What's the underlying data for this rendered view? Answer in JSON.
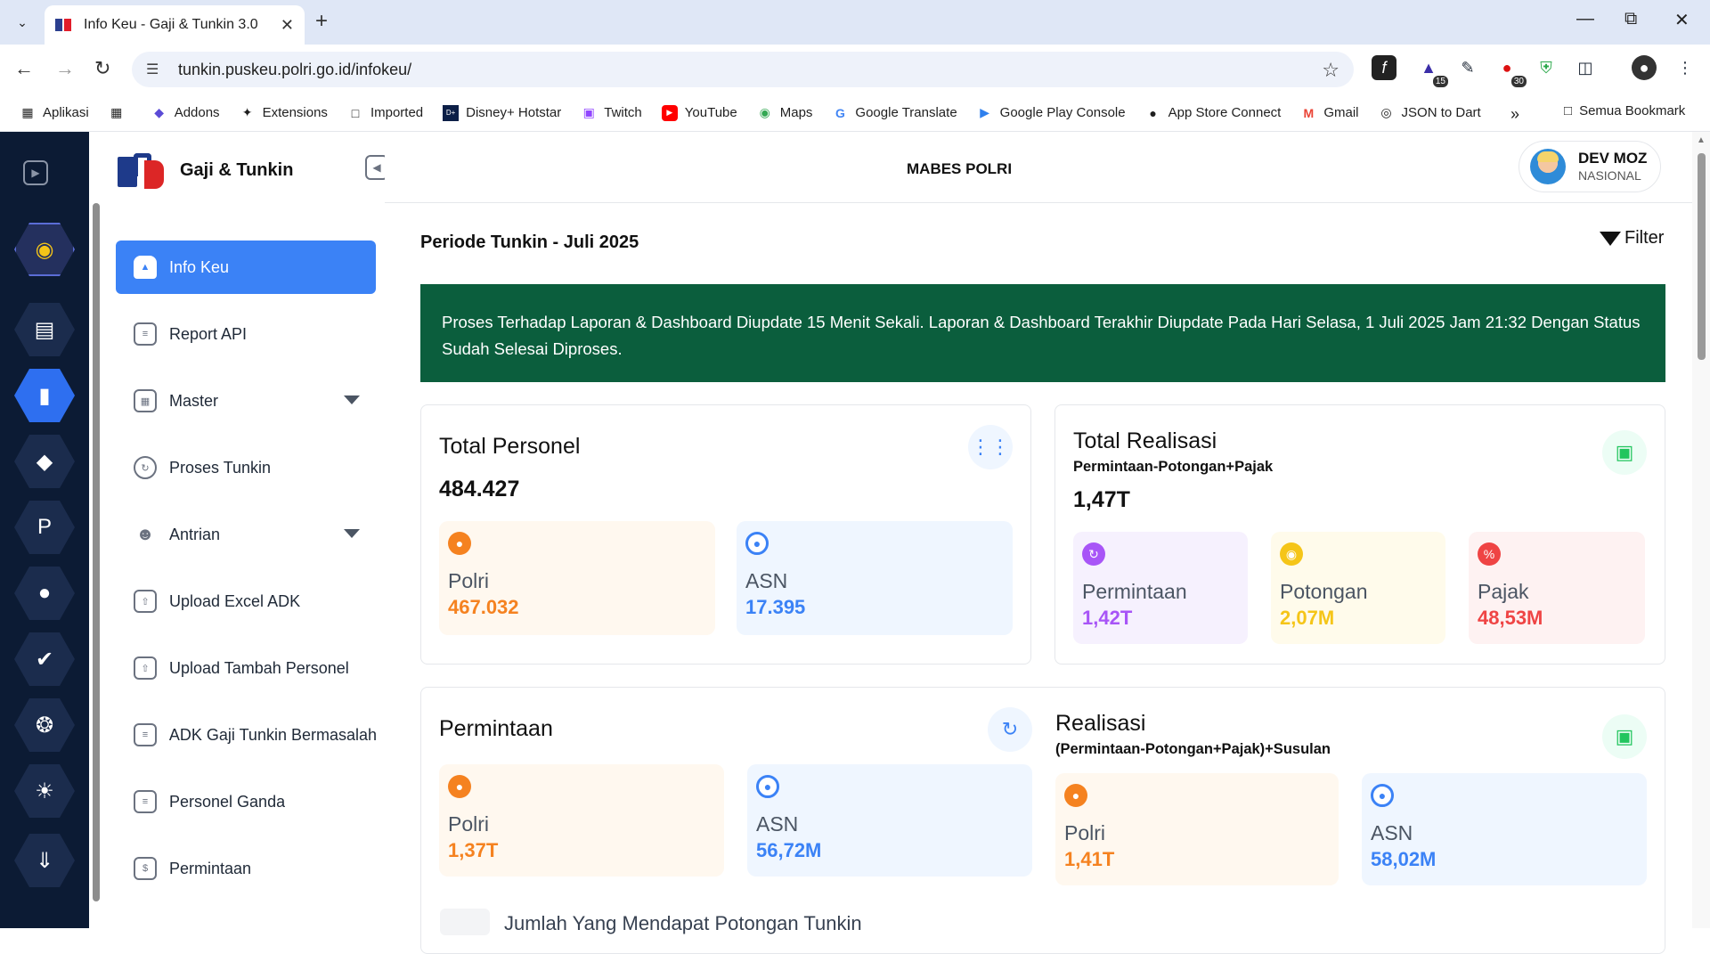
{
  "browser": {
    "tab_title": "Info Keu - Gaji & Tunkin 3.0",
    "url": "tunkin.puskeu.polri.go.id/infokeu/",
    "bookmarks": [
      {
        "label": "Aplikasi",
        "icon": "apps-grid-icon"
      },
      {
        "label": "",
        "icon": "grid-icon"
      },
      {
        "label": "Addons",
        "icon": "addons-icon"
      },
      {
        "label": "Extensions",
        "icon": "puzzle-icon"
      },
      {
        "label": "Imported",
        "icon": "folder-icon"
      },
      {
        "label": "Disney+ Hotstar",
        "icon": "hotstar-icon"
      },
      {
        "label": "Twitch",
        "icon": "twitch-icon"
      },
      {
        "label": "YouTube",
        "icon": "youtube-icon"
      },
      {
        "label": "Maps",
        "icon": "maps-icon"
      },
      {
        "label": "Google Translate",
        "icon": "google-icon"
      },
      {
        "label": "Google Play Console",
        "icon": "play-console-icon"
      },
      {
        "label": "App Store Connect",
        "icon": "apple-icon"
      },
      {
        "label": "Gmail",
        "icon": "gmail-icon"
      },
      {
        "label": "JSON to Dart",
        "icon": "globe-icon"
      }
    ],
    "all_bookmarks": "Semua Bookmark",
    "ext_badges": [
      "15",
      "30"
    ]
  },
  "app": {
    "brand_title": "Gaji & Tunkin",
    "unit": "MABES POLRI",
    "user_name": "DEV MOZ",
    "user_role": "NASIONAL"
  },
  "sidebar": {
    "items": [
      {
        "label": "Info Keu",
        "active": true,
        "icon": "home-icon"
      },
      {
        "label": "Report API",
        "icon": "clipboard-icon"
      },
      {
        "label": "Master",
        "icon": "grid-icon",
        "dropdown": true
      },
      {
        "label": "Proses Tunkin",
        "icon": "refresh-icon"
      },
      {
        "label": "Antrian",
        "icon": "user-icon",
        "dropdown": true
      },
      {
        "label": "Upload Excel ADK",
        "icon": "upload-file-icon"
      },
      {
        "label": "Upload Tambah Personel",
        "icon": "upload-file-icon"
      },
      {
        "label": "ADK Gaji Tunkin Bermasalah",
        "icon": "clipboard-icon"
      },
      {
        "label": "Personel Ganda",
        "icon": "clipboard-icon"
      },
      {
        "label": "Permintaan",
        "icon": "money-icon"
      }
    ]
  },
  "main": {
    "period": "Periode Tunkin - Juli 2025",
    "filter_label": "Filter",
    "notice": "Proses Terhadap Laporan & Dashboard Diupdate 15 Menit Sekali. Laporan & Dashboard Terakhir Diupdate Pada Hari Selasa, 1 Juli 2025 Jam 21:32 Dengan Status Sudah Selesai Diproses.",
    "total_personel": {
      "title": "Total Personel",
      "value": "484.427",
      "polri": {
        "label": "Polri",
        "value": "467.032"
      },
      "asn": {
        "label": "ASN",
        "value": "17.395"
      }
    },
    "total_realisasi": {
      "title": "Total Realisasi",
      "subtitle": "Permintaan-Potongan+Pajak",
      "value": "1,47T",
      "permintaan": {
        "label": "Permintaan",
        "value": "1,42T"
      },
      "potongan": {
        "label": "Potongan",
        "value": "2,07M"
      },
      "pajak": {
        "label": "Pajak",
        "value": "48,53M"
      }
    },
    "permintaan": {
      "title": "Permintaan",
      "polri": {
        "label": "Polri",
        "value": "1,37T"
      },
      "asn": {
        "label": "ASN",
        "value": "56,72M"
      }
    },
    "realisasi": {
      "title": "Realisasi",
      "subtitle": "(Permintaan-Potongan+Pajak)+Susulan",
      "polri": {
        "label": "Polri",
        "value": "1,41T"
      },
      "asn": {
        "label": "ASN",
        "value": "58,02M"
      }
    },
    "next_section": "Jumlah Yang Mendapat Potongan Tunkin"
  },
  "colors": {
    "accent": "#3b82f6",
    "notice_bg": "#0b5e3d",
    "rail_bg": "#0c1b34",
    "orange": "#f58220",
    "purple": "#a855f7",
    "yellow": "#f5c518",
    "red": "#ef4444"
  }
}
